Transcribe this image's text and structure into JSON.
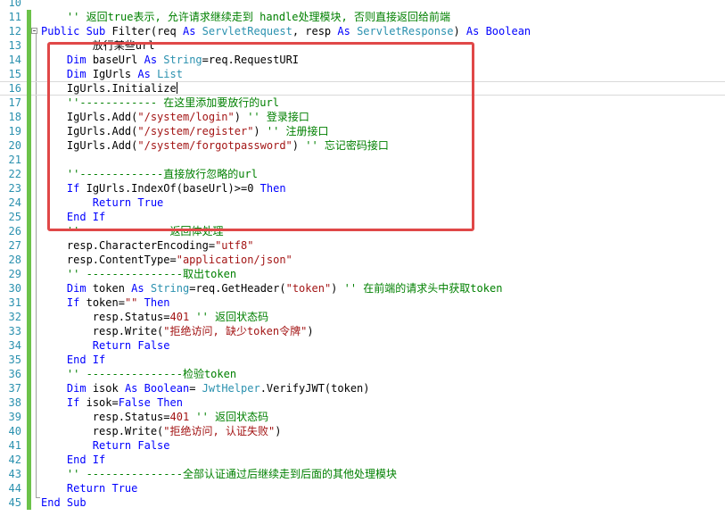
{
  "editor": {
    "language": "VB.NET",
    "caret_line": 16,
    "highlight_box_color": "#e04848",
    "lines": [
      {
        "num": "10",
        "segments": []
      },
      {
        "num": "11",
        "segments": [
          {
            "t": "    '' 返回true表示, 允许请求继续走到 handle处理模块, 否则直接返回给前端",
            "c": "cm"
          }
        ]
      },
      {
        "num": "12",
        "segments": [
          {
            "t": "Public Sub ",
            "c": "kw"
          },
          {
            "t": "Filter",
            "c": "fn"
          },
          {
            "t": "(req ",
            "c": "nm"
          },
          {
            "t": "As ",
            "c": "kw"
          },
          {
            "t": "ServletRequest",
            "c": "ty"
          },
          {
            "t": ", resp ",
            "c": "nm"
          },
          {
            "t": "As ",
            "c": "kw"
          },
          {
            "t": "ServletResponse",
            "c": "ty"
          },
          {
            "t": ") ",
            "c": "nm"
          },
          {
            "t": "As Boolean",
            "c": "kw"
          }
        ]
      },
      {
        "num": "13",
        "segments": [
          {
            "t": "        放行某些url",
            "c": "nm"
          }
        ]
      },
      {
        "num": "14",
        "segments": [
          {
            "t": "    ",
            "c": "nm"
          },
          {
            "t": "Dim ",
            "c": "kw"
          },
          {
            "t": "baseUrl ",
            "c": "nm"
          },
          {
            "t": "As ",
            "c": "kw"
          },
          {
            "t": "String",
            "c": "ty"
          },
          {
            "t": "=req.RequestURI",
            "c": "nm"
          }
        ]
      },
      {
        "num": "15",
        "segments": [
          {
            "t": "    ",
            "c": "nm"
          },
          {
            "t": "Dim ",
            "c": "kw"
          },
          {
            "t": "IgUrls ",
            "c": "nm"
          },
          {
            "t": "As ",
            "c": "kw"
          },
          {
            "t": "List",
            "c": "ty"
          }
        ]
      },
      {
        "num": "16",
        "segments": [
          {
            "t": "    IgUrls.Initialize",
            "c": "nm"
          }
        ]
      },
      {
        "num": "17",
        "segments": [
          {
            "t": "    ''------------ 在这里添加要放行的url",
            "c": "cm"
          }
        ]
      },
      {
        "num": "18",
        "segments": [
          {
            "t": "    IgUrls.Add(",
            "c": "nm"
          },
          {
            "t": "\"/system/login\"",
            "c": "st"
          },
          {
            "t": ") ",
            "c": "nm"
          },
          {
            "t": "'' 登录接口",
            "c": "cm"
          }
        ]
      },
      {
        "num": "19",
        "segments": [
          {
            "t": "    IgUrls.Add(",
            "c": "nm"
          },
          {
            "t": "\"/system/register\"",
            "c": "st"
          },
          {
            "t": ") ",
            "c": "nm"
          },
          {
            "t": "'' 注册接口",
            "c": "cm"
          }
        ]
      },
      {
        "num": "20",
        "segments": [
          {
            "t": "    IgUrls.Add(",
            "c": "nm"
          },
          {
            "t": "\"/system/forgotpassword\"",
            "c": "st"
          },
          {
            "t": ") ",
            "c": "nm"
          },
          {
            "t": "'' 忘记密码接口",
            "c": "cm"
          }
        ]
      },
      {
        "num": "21",
        "segments": []
      },
      {
        "num": "22",
        "segments": [
          {
            "t": "    ''-------------直接放行忽略的url",
            "c": "cm"
          }
        ]
      },
      {
        "num": "23",
        "segments": [
          {
            "t": "    ",
            "c": "nm"
          },
          {
            "t": "If ",
            "c": "kw"
          },
          {
            "t": "IgUrls.IndexOf(baseUrl)>=",
            "c": "nm"
          },
          {
            "t": "0",
            "c": "nm"
          },
          {
            "t": " Then",
            "c": "kw"
          }
        ]
      },
      {
        "num": "24",
        "segments": [
          {
            "t": "        ",
            "c": "nm"
          },
          {
            "t": "Return True",
            "c": "kw"
          }
        ]
      },
      {
        "num": "25",
        "segments": [
          {
            "t": "    ",
            "c": "nm"
          },
          {
            "t": "End If",
            "c": "kw"
          }
        ]
      },
      {
        "num": "26",
        "segments": [
          {
            "t": "    ''              返回体处理",
            "c": "cm"
          }
        ]
      },
      {
        "num": "27",
        "segments": [
          {
            "t": "    resp.CharacterEncoding=",
            "c": "nm"
          },
          {
            "t": "\"utf8\"",
            "c": "st"
          }
        ]
      },
      {
        "num": "28",
        "segments": [
          {
            "t": "    resp.ContentType=",
            "c": "nm"
          },
          {
            "t": "\"application/json\"",
            "c": "st"
          }
        ]
      },
      {
        "num": "29",
        "segments": [
          {
            "t": "    '' ---------------取出token",
            "c": "cm"
          }
        ]
      },
      {
        "num": "30",
        "segments": [
          {
            "t": "    ",
            "c": "nm"
          },
          {
            "t": "Dim ",
            "c": "kw"
          },
          {
            "t": "token ",
            "c": "nm"
          },
          {
            "t": "As ",
            "c": "kw"
          },
          {
            "t": "String",
            "c": "ty"
          },
          {
            "t": "=req.GetHeader(",
            "c": "nm"
          },
          {
            "t": "\"token\"",
            "c": "st"
          },
          {
            "t": ") ",
            "c": "nm"
          },
          {
            "t": "'' 在前端的请求头中获取token",
            "c": "cm"
          }
        ]
      },
      {
        "num": "31",
        "segments": [
          {
            "t": "    ",
            "c": "nm"
          },
          {
            "t": "If ",
            "c": "kw"
          },
          {
            "t": "token=",
            "c": "nm"
          },
          {
            "t": "\"\"",
            "c": "st"
          },
          {
            "t": " Then",
            "c": "kw"
          }
        ]
      },
      {
        "num": "32",
        "segments": [
          {
            "t": "        resp.Status=",
            "c": "nm"
          },
          {
            "t": "401",
            "c": "st"
          },
          {
            "t": " ",
            "c": "nm"
          },
          {
            "t": "'' 返回状态码",
            "c": "cm"
          }
        ]
      },
      {
        "num": "33",
        "segments": [
          {
            "t": "        resp.Write(",
            "c": "nm"
          },
          {
            "t": "\"拒绝访问, 缺少token令牌\"",
            "c": "st"
          },
          {
            "t": ")",
            "c": "nm"
          }
        ]
      },
      {
        "num": "34",
        "segments": [
          {
            "t": "        ",
            "c": "nm"
          },
          {
            "t": "Return False",
            "c": "kw"
          }
        ]
      },
      {
        "num": "35",
        "segments": [
          {
            "t": "    ",
            "c": "nm"
          },
          {
            "t": "End If",
            "c": "kw"
          }
        ]
      },
      {
        "num": "36",
        "segments": [
          {
            "t": "    '' ---------------检验token",
            "c": "cm"
          }
        ]
      },
      {
        "num": "37",
        "segments": [
          {
            "t": "    ",
            "c": "nm"
          },
          {
            "t": "Dim ",
            "c": "kw"
          },
          {
            "t": "isok ",
            "c": "nm"
          },
          {
            "t": "As ",
            "c": "kw"
          },
          {
            "t": "Boolean",
            "c": "kw"
          },
          {
            "t": "= ",
            "c": "nm"
          },
          {
            "t": "JwtHelper",
            "c": "ty"
          },
          {
            "t": ".VerifyJWT(token)",
            "c": "nm"
          }
        ]
      },
      {
        "num": "38",
        "segments": [
          {
            "t": "    ",
            "c": "nm"
          },
          {
            "t": "If ",
            "c": "kw"
          },
          {
            "t": "isok=",
            "c": "nm"
          },
          {
            "t": "False",
            "c": "kw"
          },
          {
            "t": " Then",
            "c": "kw"
          }
        ]
      },
      {
        "num": "39",
        "segments": [
          {
            "t": "        resp.Status=",
            "c": "nm"
          },
          {
            "t": "401",
            "c": "st"
          },
          {
            "t": " ",
            "c": "nm"
          },
          {
            "t": "'' 返回状态码",
            "c": "cm"
          }
        ]
      },
      {
        "num": "40",
        "segments": [
          {
            "t": "        resp.Write(",
            "c": "nm"
          },
          {
            "t": "\"拒绝访问, 认证失败\"",
            "c": "st"
          },
          {
            "t": ")",
            "c": "nm"
          }
        ]
      },
      {
        "num": "41",
        "segments": [
          {
            "t": "        ",
            "c": "nm"
          },
          {
            "t": "Return False",
            "c": "kw"
          }
        ]
      },
      {
        "num": "42",
        "segments": [
          {
            "t": "    ",
            "c": "nm"
          },
          {
            "t": "End If",
            "c": "kw"
          }
        ]
      },
      {
        "num": "43",
        "segments": [
          {
            "t": "    '' ---------------全部认证通过后继续走到后面的其他处理模块",
            "c": "cm"
          }
        ]
      },
      {
        "num": "44",
        "segments": [
          {
            "t": "    ",
            "c": "nm"
          },
          {
            "t": "Return True",
            "c": "kw"
          }
        ]
      },
      {
        "num": "45",
        "segments": [
          {
            "t": "End Sub",
            "c": "kw"
          }
        ]
      }
    ]
  }
}
